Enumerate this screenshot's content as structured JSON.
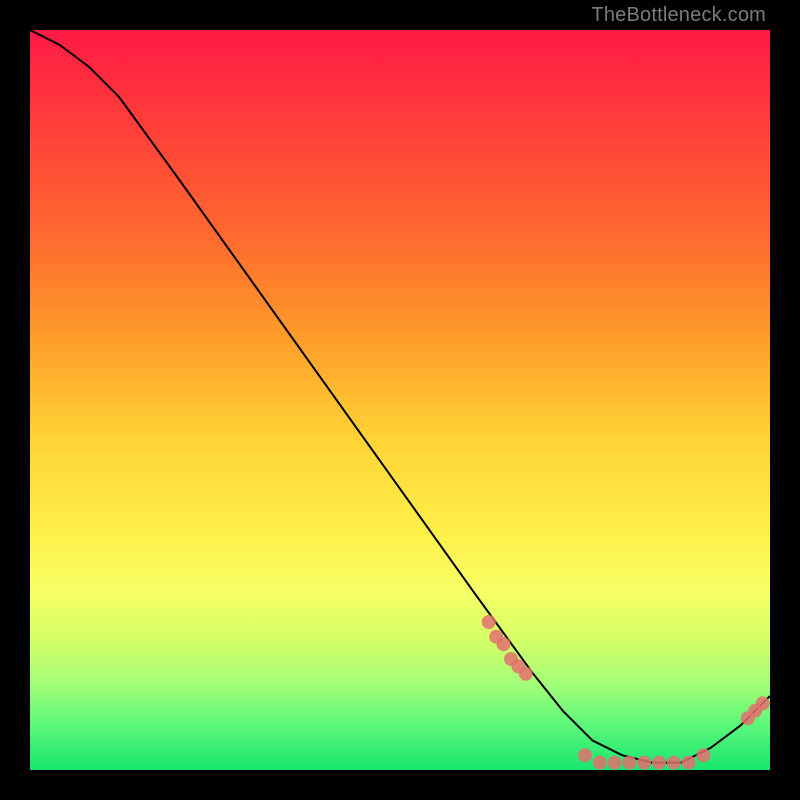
{
  "watermark": "TheBottleneck.com",
  "chart_data": {
    "type": "line",
    "title": "",
    "xlabel": "",
    "ylabel": "",
    "xlim": [
      0,
      100
    ],
    "ylim": [
      0,
      100
    ],
    "grid": false,
    "legend": false,
    "series": [
      {
        "name": "curve",
        "color": "#000000",
        "x": [
          0,
          4,
          8,
          12,
          20,
          30,
          40,
          50,
          60,
          68,
          72,
          76,
          80,
          84,
          88,
          92,
          96,
          100
        ],
        "y": [
          100,
          98,
          95,
          91,
          80,
          66,
          52,
          38,
          24,
          13,
          8,
          4,
          2,
          1,
          1,
          3,
          6,
          10
        ]
      }
    ],
    "markers": [
      {
        "name": "left-cluster",
        "color": "#e4706f",
        "x": [
          62,
          63,
          64,
          65,
          66,
          67
        ],
        "y": [
          20,
          18,
          17,
          15,
          14,
          13
        ]
      },
      {
        "name": "bottom-cluster",
        "color": "#e4706f",
        "x": [
          75,
          77,
          79,
          81,
          83,
          85,
          87,
          89,
          91
        ],
        "y": [
          2,
          1,
          1,
          1,
          1,
          1,
          1,
          1,
          2
        ]
      },
      {
        "name": "right-cluster",
        "color": "#e4706f",
        "x": [
          97,
          98,
          99
        ],
        "y": [
          7,
          8,
          9
        ]
      }
    ]
  }
}
